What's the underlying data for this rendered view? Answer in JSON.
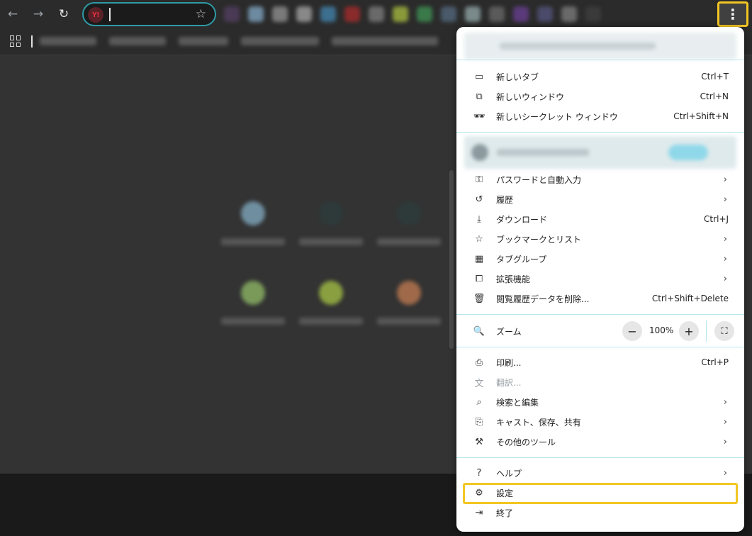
{
  "toolbar": {
    "back_icon": "←",
    "forward_icon": "→",
    "reload_icon": "↻",
    "site_badge": "Y!",
    "bookmark_star": "☆",
    "menu_icon": "⋮"
  },
  "menu": {
    "group1": [
      {
        "label": "新しいタブ",
        "shortcut": "Ctrl+T",
        "icon": "▭",
        "icon_name": "new-tab-icon"
      },
      {
        "label": "新しいウィンドウ",
        "shortcut": "Ctrl+N",
        "icon": "⧉",
        "icon_name": "new-window-icon"
      },
      {
        "label": "新しいシークレット ウィンドウ",
        "shortcut": "Ctrl+Shift+N",
        "icon": "🕶",
        "icon_name": "incognito-icon"
      }
    ],
    "group2": [
      {
        "label": "パスワードと自動入力",
        "chevron": "›",
        "icon": "⚿",
        "icon_name": "key-icon"
      },
      {
        "label": "履歴",
        "chevron": "›",
        "icon": "↺",
        "icon_name": "history-icon"
      },
      {
        "label": "ダウンロード",
        "shortcut": "Ctrl+J",
        "icon": "⤓",
        "icon_name": "download-icon"
      },
      {
        "label": "ブックマークとリスト",
        "chevron": "›",
        "icon": "☆",
        "icon_name": "star-icon"
      },
      {
        "label": "タブグループ",
        "chevron": "›",
        "icon": "▦",
        "icon_name": "tab-groups-icon"
      },
      {
        "label": "拡張機能",
        "chevron": "›",
        "icon": "⧠",
        "icon_name": "extension-icon"
      },
      {
        "label": "閲覧履歴データを削除...",
        "shortcut": "Ctrl+Shift+Delete",
        "icon": "🗑",
        "icon_name": "trash-icon"
      }
    ],
    "zoom": {
      "label": "ズーム",
      "value": "100%",
      "minus": "−",
      "plus": "+",
      "fullscreen": "⛶",
      "icon": "🔍"
    },
    "group3": [
      {
        "label": "印刷...",
        "shortcut": "Ctrl+P",
        "icon": "⎙",
        "icon_name": "print-icon"
      },
      {
        "label": "翻訳...",
        "icon": "文",
        "icon_name": "translate-icon",
        "disabled": true
      },
      {
        "label": "検索と編集",
        "chevron": "›",
        "icon": "⌕",
        "icon_name": "search-edit-icon"
      },
      {
        "label": "キャスト、保存、共有",
        "chevron": "›",
        "icon": "⎘",
        "icon_name": "cast-icon"
      },
      {
        "label": "その他のツール",
        "chevron": "›",
        "icon": "⚒",
        "icon_name": "toolbox-icon"
      }
    ],
    "group4": [
      {
        "label": "ヘルプ",
        "chevron": "›",
        "icon": "?",
        "icon_name": "help-icon"
      },
      {
        "label": "設定",
        "icon": "⚙",
        "icon_name": "settings-icon"
      },
      {
        "label": "終了",
        "icon": "⇥",
        "icon_name": "exit-icon"
      }
    ]
  },
  "colors": {
    "highlight": "#f3c623",
    "accent": "#2f9aa6",
    "divider": "#b8e6ee"
  }
}
